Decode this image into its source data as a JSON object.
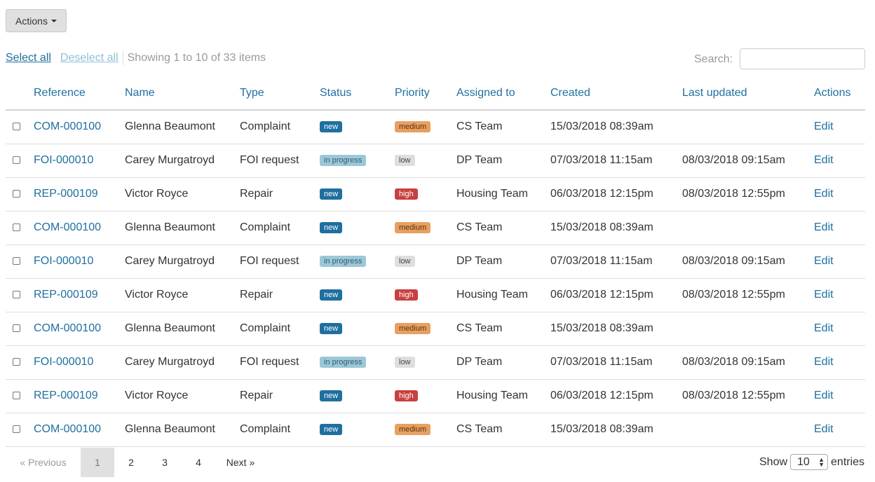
{
  "actions_label": "Actions",
  "toolbar": {
    "select_all": "Select all",
    "deselect_all": "Deselect all",
    "showing": "Showing 1 to 10 of 33 items"
  },
  "search": {
    "label": "Search:",
    "value": "",
    "placeholder": ""
  },
  "columns": [
    "Reference",
    "Name",
    "Type",
    "Status",
    "Priority",
    "Assigned to",
    "Created",
    "Last updated",
    "Actions"
  ],
  "rows": [
    {
      "ref": "COM-000100",
      "name": "Glenna Beaumont",
      "type": "Complaint",
      "status": "new",
      "priority": "medium",
      "assigned": "CS Team",
      "created": "15/03/2018 08:39am",
      "updated": "",
      "action": "Edit"
    },
    {
      "ref": "FOI-000010",
      "name": "Carey Murgatroyd",
      "type": "FOI request",
      "status": "in progress",
      "priority": "low",
      "assigned": "DP Team",
      "created": "07/03/2018 11:15am",
      "updated": "08/03/2018 09:15am",
      "action": "Edit"
    },
    {
      "ref": "REP-000109",
      "name": "Victor Royce",
      "type": "Repair",
      "status": "new",
      "priority": "high",
      "assigned": "Housing Team",
      "created": "06/03/2018 12:15pm",
      "updated": "08/03/2018 12:55pm",
      "action": "Edit"
    },
    {
      "ref": "COM-000100",
      "name": "Glenna Beaumont",
      "type": "Complaint",
      "status": "new",
      "priority": "medium",
      "assigned": "CS Team",
      "created": "15/03/2018 08:39am",
      "updated": "",
      "action": "Edit"
    },
    {
      "ref": "FOI-000010",
      "name": "Carey Murgatroyd",
      "type": "FOI request",
      "status": "in progress",
      "priority": "low",
      "assigned": "DP Team",
      "created": "07/03/2018 11:15am",
      "updated": "08/03/2018 09:15am",
      "action": "Edit"
    },
    {
      "ref": "REP-000109",
      "name": "Victor Royce",
      "type": "Repair",
      "status": "new",
      "priority": "high",
      "assigned": "Housing Team",
      "created": "06/03/2018 12:15pm",
      "updated": "08/03/2018 12:55pm",
      "action": "Edit"
    },
    {
      "ref": "COM-000100",
      "name": "Glenna Beaumont",
      "type": "Complaint",
      "status": "new",
      "priority": "medium",
      "assigned": "CS Team",
      "created": "15/03/2018 08:39am",
      "updated": "",
      "action": "Edit"
    },
    {
      "ref": "FOI-000010",
      "name": "Carey Murgatroyd",
      "type": "FOI request",
      "status": "in progress",
      "priority": "low",
      "assigned": "DP Team",
      "created": "07/03/2018 11:15am",
      "updated": "08/03/2018 09:15am",
      "action": "Edit"
    },
    {
      "ref": "REP-000109",
      "name": "Victor Royce",
      "type": "Repair",
      "status": "new",
      "priority": "high",
      "assigned": "Housing Team",
      "created": "06/03/2018 12:15pm",
      "updated": "08/03/2018 12:55pm",
      "action": "Edit"
    },
    {
      "ref": "COM-000100",
      "name": "Glenna Beaumont",
      "type": "Complaint",
      "status": "new",
      "priority": "medium",
      "assigned": "CS Team",
      "created": "15/03/2018 08:39am",
      "updated": "",
      "action": "Edit"
    }
  ],
  "pagination": {
    "previous": "« Previous",
    "pages": [
      "1",
      "2",
      "3",
      "4"
    ],
    "active": "1",
    "next": "Next »"
  },
  "page_length": {
    "show": "Show",
    "value": "10",
    "entries": "entries"
  },
  "colors": {
    "link": "#1f6f9f",
    "badge_new": "#1f6f9f",
    "badge_in_progress": "#9ac8d8",
    "badge_medium": "#e8a060",
    "badge_low": "#dedede",
    "badge_high": "#c84040"
  }
}
